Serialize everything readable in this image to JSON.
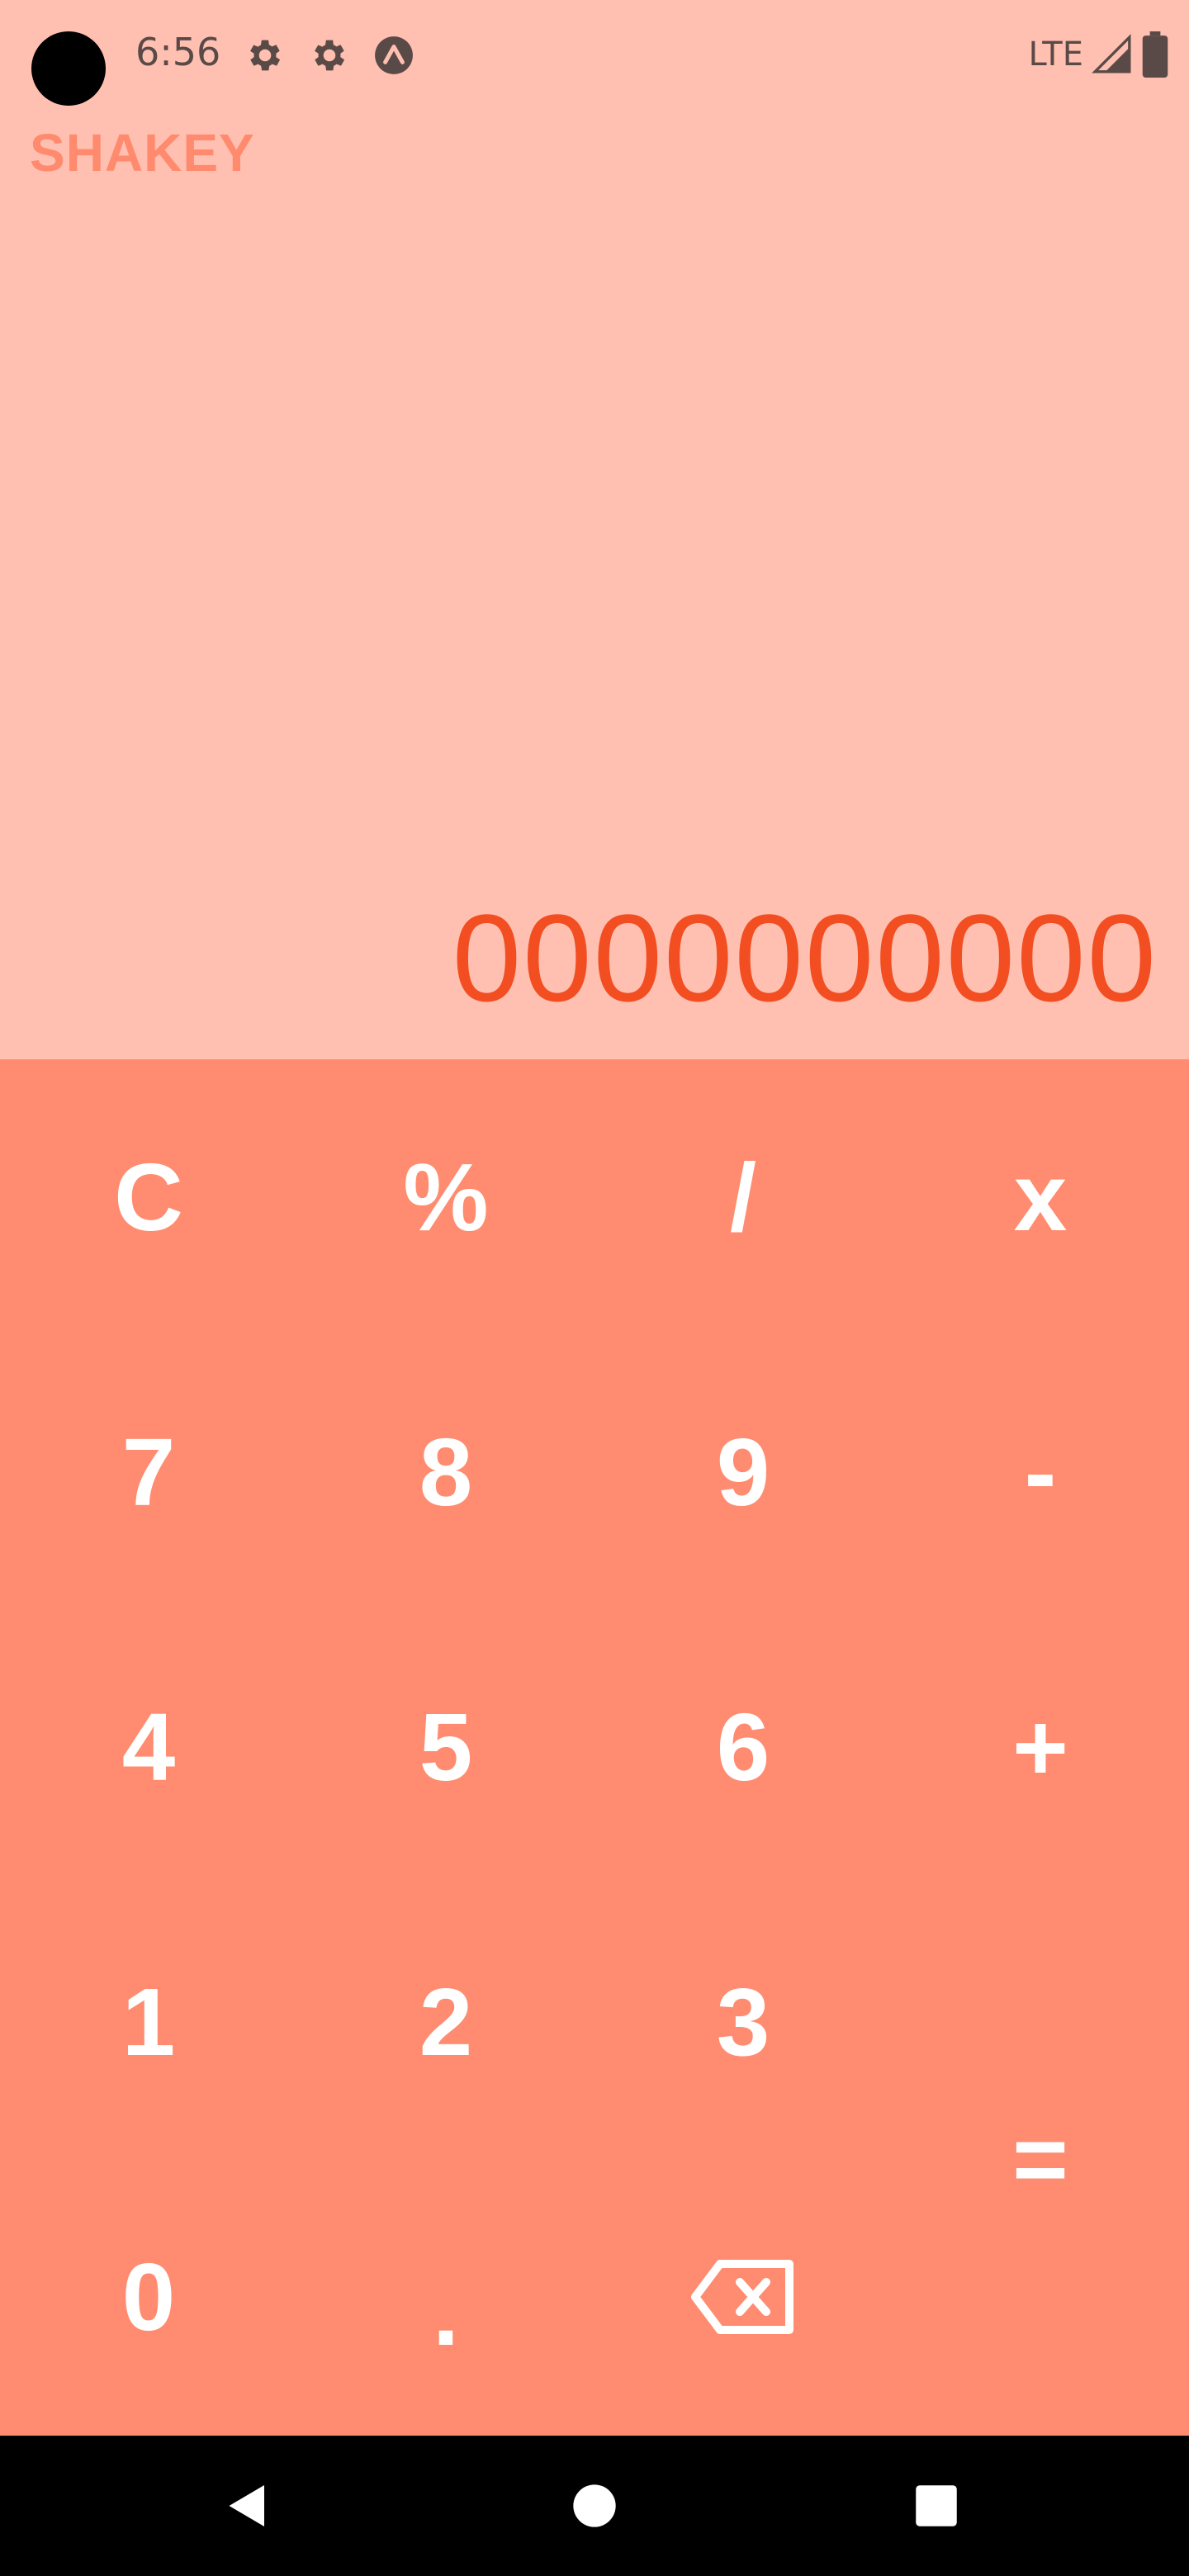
{
  "status_bar": {
    "time": "6:56",
    "network": "LTE",
    "icons": [
      "settings-icon",
      "settings-icon",
      "expo-icon",
      "signal-icon",
      "battery-icon"
    ]
  },
  "app": {
    "title": "SHAKEY"
  },
  "display": {
    "value": "0000000000"
  },
  "keypad": {
    "keys": [
      {
        "label": "C",
        "name": "clear-button"
      },
      {
        "label": "%",
        "name": "percent-button"
      },
      {
        "label": "/",
        "name": "divide-button"
      },
      {
        "label": "x",
        "name": "multiply-button"
      },
      {
        "label": "7",
        "name": "digit-7-button"
      },
      {
        "label": "8",
        "name": "digit-8-button"
      },
      {
        "label": "9",
        "name": "digit-9-button"
      },
      {
        "label": "-",
        "name": "subtract-button"
      },
      {
        "label": "4",
        "name": "digit-4-button"
      },
      {
        "label": "5",
        "name": "digit-5-button"
      },
      {
        "label": "6",
        "name": "digit-6-button"
      },
      {
        "label": "+",
        "name": "add-button"
      },
      {
        "label": "1",
        "name": "digit-1-button"
      },
      {
        "label": "2",
        "name": "digit-2-button"
      },
      {
        "label": "3",
        "name": "digit-3-button"
      },
      {
        "label": "=",
        "name": "equals-button"
      },
      {
        "label": "0",
        "name": "digit-0-button"
      },
      {
        "label": ".",
        "name": "decimal-button"
      },
      {
        "label": "",
        "name": "backspace-button",
        "icon": "backspace-icon"
      }
    ]
  },
  "colors": {
    "background": "#ffc0b1",
    "keypad": "#ff8c70",
    "display_text": "#f24e22",
    "title_text": "#ff8a6e",
    "key_text": "#ffffff"
  },
  "nav_bar": {
    "icons": [
      "back-icon",
      "home-icon",
      "recents-icon"
    ]
  }
}
